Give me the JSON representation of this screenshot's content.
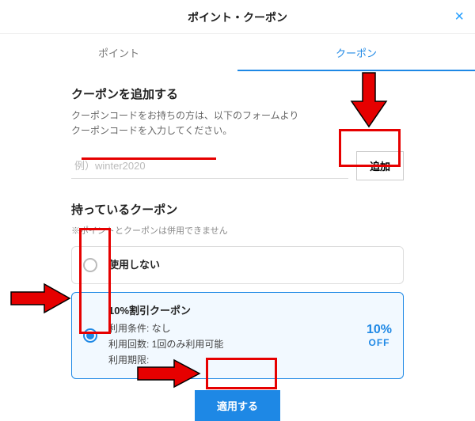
{
  "header": {
    "title": "ポイント・クーポン"
  },
  "tabs": {
    "points": "ポイント",
    "coupons": "クーポン"
  },
  "addSection": {
    "title": "クーポンを追加する",
    "desc1": "クーポンコードをお持ちの方は、以下のフォームより",
    "desc2": "クーポンコードを入力してください。",
    "placeholder": "例）winter2020",
    "addLabel": "追加"
  },
  "ownedSection": {
    "title": "持っているクーポン",
    "note": "※ポイントとクーポンは併用できません"
  },
  "options": {
    "noneLabel": "使用しない",
    "coupon": {
      "title": "10%割引クーポン",
      "cond": "利用条件: なし",
      "times": "利用回数: 1回のみ利用可能",
      "period": "利用期限:",
      "pct": "10%",
      "off": "OFF"
    }
  },
  "apply": "適用する"
}
